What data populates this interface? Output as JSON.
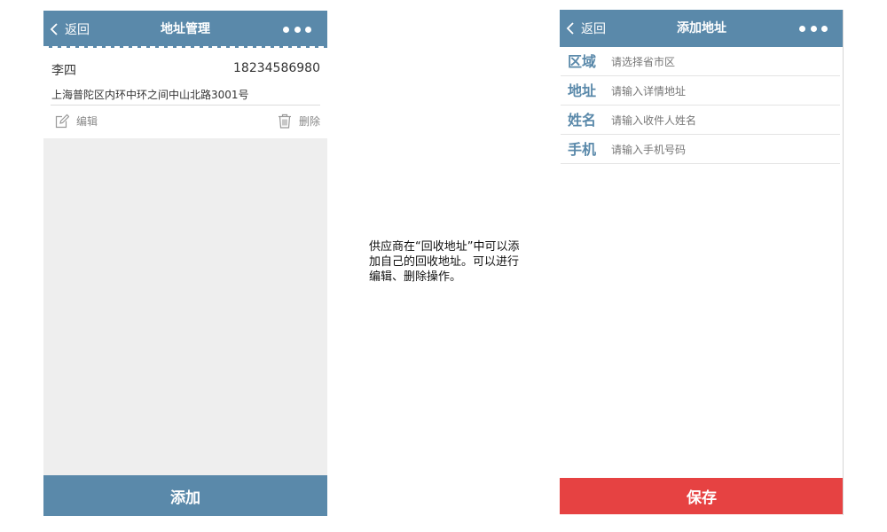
{
  "left_screen": {
    "nav": {
      "back_label": "返回",
      "title": "地址管理"
    },
    "address": {
      "name": "李四",
      "phone": "18234586980",
      "detail": "上海普陀区内环中环之间中山北路3001号",
      "edit_label": "编辑",
      "delete_label": "删除"
    },
    "add_button_label": "添加"
  },
  "description": "供应商在“回收地址”中可以添加自己的回收地址。可以进行编辑、删除操作。",
  "right_screen": {
    "nav": {
      "back_label": "返回",
      "title": "添加地址"
    },
    "fields": [
      {
        "label": "区域",
        "placeholder": "请选择省市区"
      },
      {
        "label": "地址",
        "placeholder": "请输入详情地址"
      },
      {
        "label": "姓名",
        "placeholder": "请输入收件人姓名"
      },
      {
        "label": "手机",
        "placeholder": "请输入手机号码"
      }
    ],
    "save_button_label": "保存"
  },
  "colors": {
    "nav_blue": "#5a89aa",
    "save_red": "#e64242",
    "gray_bg": "#eeeeee"
  },
  "icons": [
    "chevron-left-icon",
    "more-dots-icon",
    "edit-icon",
    "trash-icon"
  ]
}
